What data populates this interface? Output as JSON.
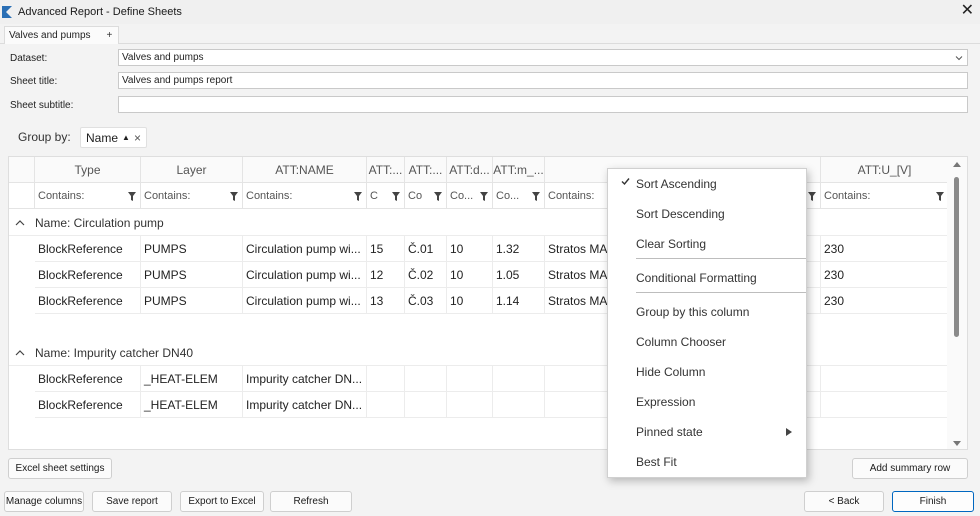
{
  "window": {
    "title": "Advanced Report - Define Sheets"
  },
  "tabs": {
    "active": "Valves and pumps",
    "add": "+"
  },
  "form": {
    "dataset_label": "Dataset:",
    "dataset_value": "Valves and pumps",
    "title_label": "Sheet title:",
    "title_value": "Valves and pumps report",
    "subtitle_label": "Sheet subtitle:",
    "subtitle_value": ""
  },
  "groupby": {
    "label": "Group by:",
    "chip": "Name",
    "asc": "▲",
    "remove": "×"
  },
  "columns": [
    {
      "header": "Type",
      "filter": "Contains:"
    },
    {
      "header": "Layer",
      "filter": "Contains:"
    },
    {
      "header": "ATT:NAME",
      "filter": "Contains:"
    },
    {
      "header": "ATT:...",
      "filter": "C"
    },
    {
      "header": "ATT:...",
      "filter": "Co"
    },
    {
      "header": "ATT:d...",
      "filter": "Co..."
    },
    {
      "header": "ATT:m_...",
      "filter": "Co..."
    },
    {
      "header": "",
      "filter": "Contains:"
    },
    {
      "header": "ATT:U_[V]",
      "filter": "Contains:"
    }
  ],
  "groups": [
    {
      "title": "Name: Circulation pump",
      "rows": [
        [
          "BlockReference",
          "PUMPS",
          "Circulation pump wi...",
          "15",
          "Č.01",
          "10",
          "1.32",
          "Stratos MAX",
          "230"
        ],
        [
          "BlockReference",
          "PUMPS",
          "Circulation pump wi...",
          "12",
          "Č.02",
          "10",
          "1.05",
          "Stratos MAX",
          "230"
        ],
        [
          "BlockReference",
          "PUMPS",
          "Circulation pump wi...",
          "13",
          "Č.03",
          "10",
          "1.14",
          "Stratos MAX",
          "230"
        ]
      ]
    },
    {
      "title": "Name: Impurity catcher DN40",
      "rows": [
        [
          "BlockReference",
          "_HEAT-ELEM",
          "Impurity catcher DN...",
          "",
          "",
          "",
          "",
          "",
          ""
        ],
        [
          "BlockReference",
          "_HEAT-ELEM",
          "Impurity catcher DN...",
          "",
          "",
          "",
          "",
          "",
          ""
        ]
      ]
    }
  ],
  "context_menu": {
    "items": [
      {
        "label": "Sort Ascending",
        "checked": true
      },
      {
        "label": "Sort Descending"
      },
      {
        "label": "Clear Sorting"
      },
      {
        "label": "Conditional Formatting"
      },
      {
        "label": "Group by this column"
      },
      {
        "label": "Column Chooser"
      },
      {
        "label": "Hide Column"
      },
      {
        "label": "Expression"
      },
      {
        "label": "Pinned state",
        "submenu": true
      },
      {
        "label": "Best Fit"
      }
    ]
  },
  "buttons": {
    "excel_settings": "Excel sheet settings",
    "add_summary": "Add summary row",
    "manage_columns": "Manage columns",
    "save_report": "Save report",
    "export_excel": "Export to Excel",
    "refresh": "Refresh",
    "back": "< Back",
    "finish": "Finish"
  },
  "colors": {
    "accent": "#0067c0",
    "check": "#333333"
  }
}
